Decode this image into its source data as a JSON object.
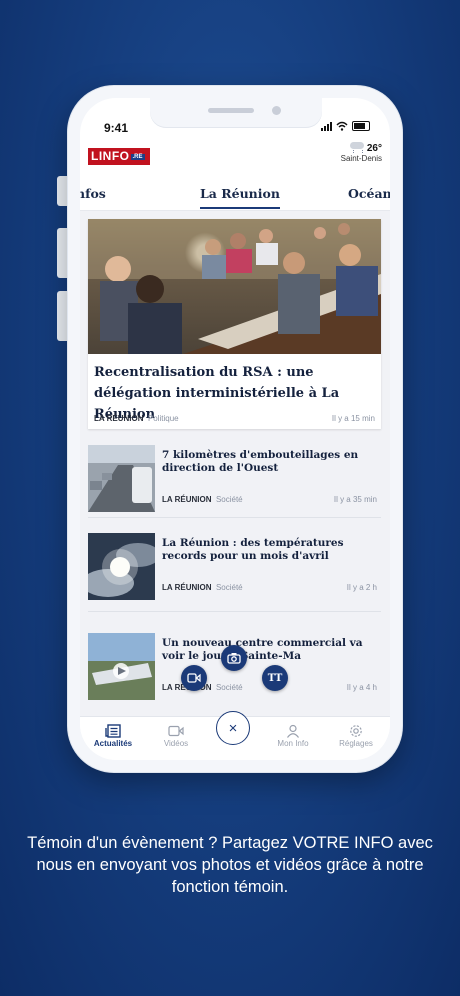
{
  "status_bar": {
    "time": "9:41"
  },
  "header": {
    "logo_text": "LINFO",
    "logo_suffix": ".RE",
    "weather": {
      "temperature": "26°",
      "city": "Saint-Denis",
      "icon": "cloud-rain-icon"
    }
  },
  "tabs": [
    {
      "label": "nfos"
    },
    {
      "label": "La Réunion",
      "active": true
    },
    {
      "label": "Océan"
    }
  ],
  "hero": {
    "title": "Recentralisation du RSA : une délégation interministérielle à La Réunion",
    "region": "LA RÉUNION",
    "category": "Politique",
    "time": "Il y a 15 min"
  },
  "articles": [
    {
      "title": "7 kilomètres d'embouteillages en direction de l'Ouest",
      "region": "LA RÉUNION",
      "category": "Société",
      "time": "Il y a 35 min"
    },
    {
      "title": "La Réunion : des températures records pour un mois d'avril",
      "region": "LA RÉUNION",
      "category": "Société",
      "time": "Il y a 2 h"
    },
    {
      "title": "Un nouveau centre commercial va voir le jour à Sainte-Ma",
      "region": "LA RÉUNION",
      "category": "Société",
      "time": "Il y a 4 h"
    }
  ],
  "fab_actions": [
    {
      "icon": "video-camera-icon"
    },
    {
      "icon": "camera-icon"
    },
    {
      "icon": "text-icon",
      "label": "TT"
    }
  ],
  "tabbar": {
    "items": [
      {
        "label": "Actualités",
        "icon": "newspaper-icon",
        "active": true
      },
      {
        "label": "Vidéos",
        "icon": "video-icon"
      },
      {
        "label": "Mon Info",
        "icon": "user-icon"
      },
      {
        "label": "Réglages",
        "icon": "gear-icon"
      }
    ],
    "close_label": "×"
  },
  "caption": "Témoin d'un évènement ? Partagez VOTRE INFO avec nous en envoyant vos photos et vidéos grâce à notre fonction témoin.",
  "colors": {
    "background": "#163f80",
    "accent": "#1b3a78",
    "logo_red": "#c1121f"
  }
}
